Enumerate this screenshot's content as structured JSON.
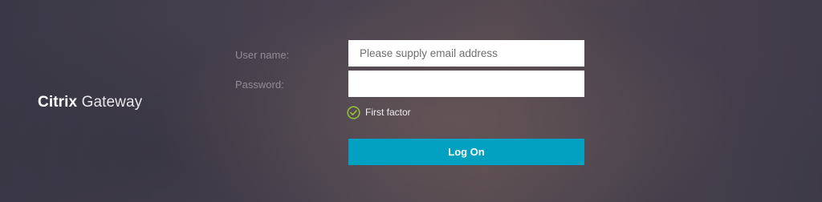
{
  "brand": {
    "strong": "Citrix",
    "light": "Gateway"
  },
  "form": {
    "username_label": "User name:",
    "username_placeholder": "Please supply email address",
    "username_value": "",
    "password_label": "Password:",
    "password_value": "",
    "factor_icon": "check-circle-icon",
    "factor_text": "First factor",
    "submit_label": "Log On"
  },
  "colors": {
    "accent": "#02a1c1",
    "check": "#8fbf3a"
  }
}
